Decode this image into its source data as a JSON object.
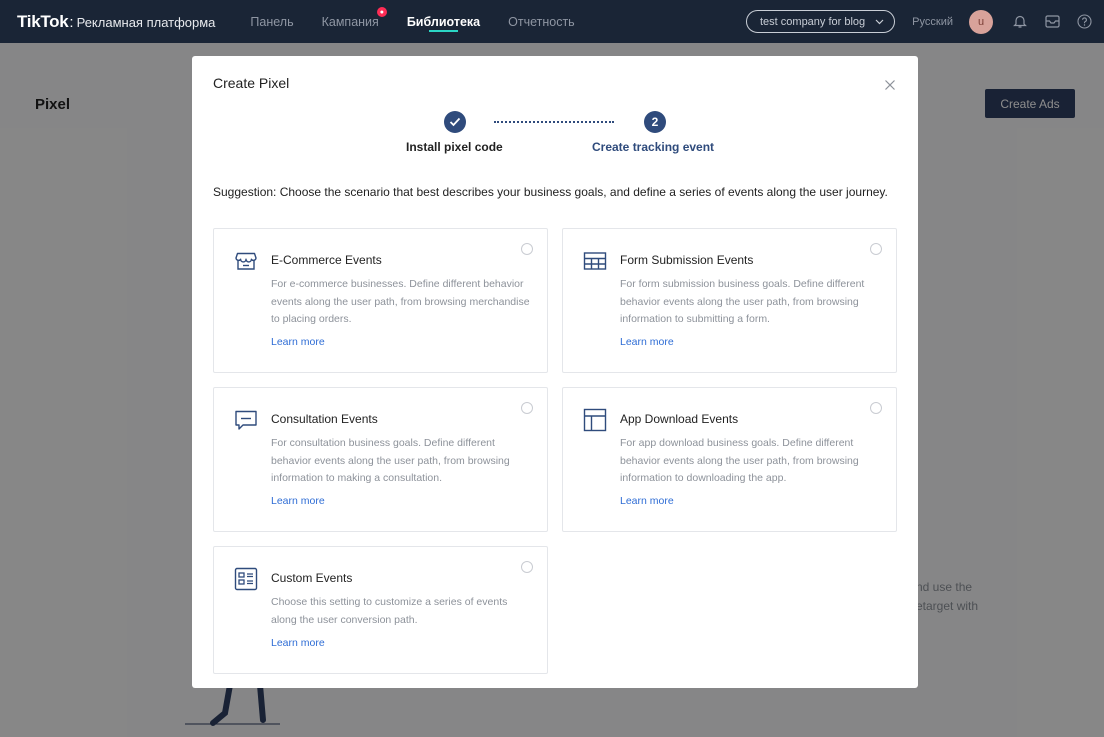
{
  "topbar": {
    "logo": "TikTok",
    "logo_sep": ":",
    "subtitle": "Рекламная платформа",
    "nav": [
      {
        "label": "Панель",
        "active": false
      },
      {
        "label": "Кампания",
        "active": false,
        "badge": true
      },
      {
        "label": "Библиотека",
        "active": true
      },
      {
        "label": "Отчетность",
        "active": false
      }
    ],
    "account": "test company for blog",
    "language": "Русский",
    "avatar_letter": "u",
    "icons": [
      "bell-icon",
      "mail-icon",
      "help-icon"
    ]
  },
  "page": {
    "title": "Pixel",
    "create_ads": "Create Ads",
    "bg_text_line1": "nd use the",
    "bg_text_line2": "etarget with"
  },
  "modal": {
    "title": "Create Pixel",
    "steps": [
      {
        "label": "Install pixel code",
        "state": "done"
      },
      {
        "number": "2",
        "label": "Create tracking event",
        "state": "current"
      }
    ],
    "suggestion": "Suggestion: Choose the scenario that best describes your business goals, and define a series of events along the user journey.",
    "cards": [
      {
        "icon": "shop-icon",
        "title": "E-Commerce Events",
        "desc": "For e-commerce businesses. Define different behavior events along the user path, from browsing merchandise to placing orders.",
        "link": "Learn more"
      },
      {
        "icon": "table-icon",
        "title": "Form Submission Events",
        "desc": "For form submission business goals. Define different behavior events along the user path, from browsing information to submitting a form.",
        "link": "Learn more"
      },
      {
        "icon": "chat-icon",
        "title": "Consultation Events",
        "desc": "For consultation business goals. Define different behavior events along the user path, from browsing information to making a consultation.",
        "link": "Learn more"
      },
      {
        "icon": "app-layout-icon",
        "title": "App Download Events",
        "desc": "For app download business goals. Define different behavior events along the user path, from browsing information to downloading the app.",
        "link": "Learn more"
      },
      {
        "icon": "custom-list-icon",
        "title": "Custom Events",
        "desc": "Choose this setting to customize a series of events along the user conversion path.",
        "link": "Learn more"
      }
    ]
  },
  "colors": {
    "topbar": "#1a2536",
    "accent": "#2f4b7c",
    "link": "#2f6dd5",
    "nav_underline": "#2bd6c5"
  }
}
